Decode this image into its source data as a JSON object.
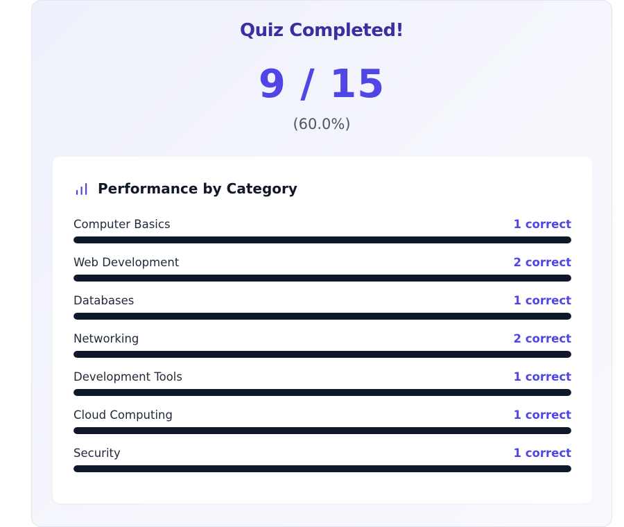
{
  "quiz": {
    "title": "Quiz Completed!",
    "score": "9 / 15",
    "percent": "(60.0%)"
  },
  "performance": {
    "title": "Performance by Category",
    "icon": "bar-chart-icon",
    "accent_color": "#4f46e5",
    "bar_color": "#0f172a",
    "categories": [
      {
        "name": "Computer Basics",
        "count": "1 correct",
        "fill": 1.0
      },
      {
        "name": "Web Development",
        "count": "2 correct",
        "fill": 1.0
      },
      {
        "name": "Databases",
        "count": "1 correct",
        "fill": 1.0
      },
      {
        "name": "Networking",
        "count": "2 correct",
        "fill": 1.0
      },
      {
        "name": "Development Tools",
        "count": "1 correct",
        "fill": 1.0
      },
      {
        "name": "Cloud Computing",
        "count": "1 correct",
        "fill": 1.0
      },
      {
        "name": "Security",
        "count": "1 correct",
        "fill": 1.0
      }
    ]
  }
}
